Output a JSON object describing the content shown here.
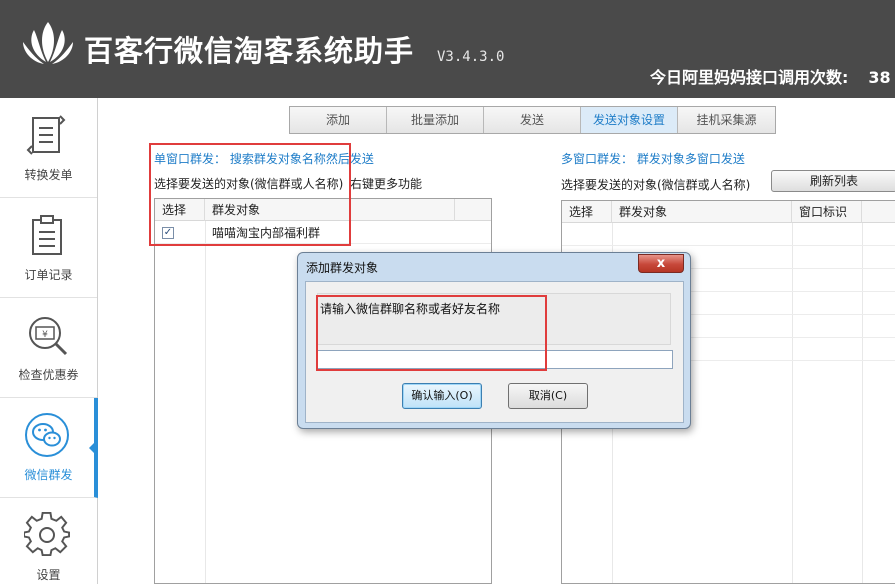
{
  "header": {
    "title": "百客行微信淘客系统助手",
    "version": "V3.4.3.0",
    "api_label": "今日阿里妈妈接口调用次数:",
    "api_count": "38"
  },
  "sidebar": {
    "items": [
      {
        "label": "转换发单",
        "icon": "convert-document-icon"
      },
      {
        "label": "订单记录",
        "icon": "clipboard-icon"
      },
      {
        "label": "检查优惠券",
        "icon": "coupon-search-icon"
      },
      {
        "label": "微信群发",
        "icon": "wechat-icon"
      },
      {
        "label": "设置",
        "icon": "gear-icon"
      }
    ],
    "active_index": 3
  },
  "tabs": [
    {
      "label": "添加"
    },
    {
      "label": "批量添加"
    },
    {
      "label": "发送"
    },
    {
      "label": "发送对象设置"
    },
    {
      "label": "挂机采集源"
    }
  ],
  "left_panel": {
    "title": "单窗口群发： 搜索群发对象名称然后发送",
    "subtitle": "选择要发送的对象(微信群或人名称)",
    "hint": "右键更多功能",
    "columns": [
      "选择",
      "群发对象"
    ],
    "rows": [
      {
        "checked": true,
        "name": "喵喵淘宝内部福利群"
      }
    ]
  },
  "right_panel": {
    "title": "多窗口群发： 群发对象多窗口发送",
    "subtitle": "选择要发送的对象(微信群或人名称)",
    "refresh_label": "刷新列表",
    "columns": [
      "选择",
      "群发对象",
      "窗口标识"
    ]
  },
  "dialog": {
    "title": "添加群发对象",
    "close_glyph": "x",
    "prompt": "请输入微信群聊名称或者好友名称",
    "input_value": "",
    "confirm_label": "确认输入(O)",
    "cancel_label": "取消(C)"
  },
  "colors": {
    "header_bg": "#4a4a4a",
    "accent": "#2a8fd8",
    "link": "#1f7dc8",
    "highlight_box": "#e03c3c"
  }
}
